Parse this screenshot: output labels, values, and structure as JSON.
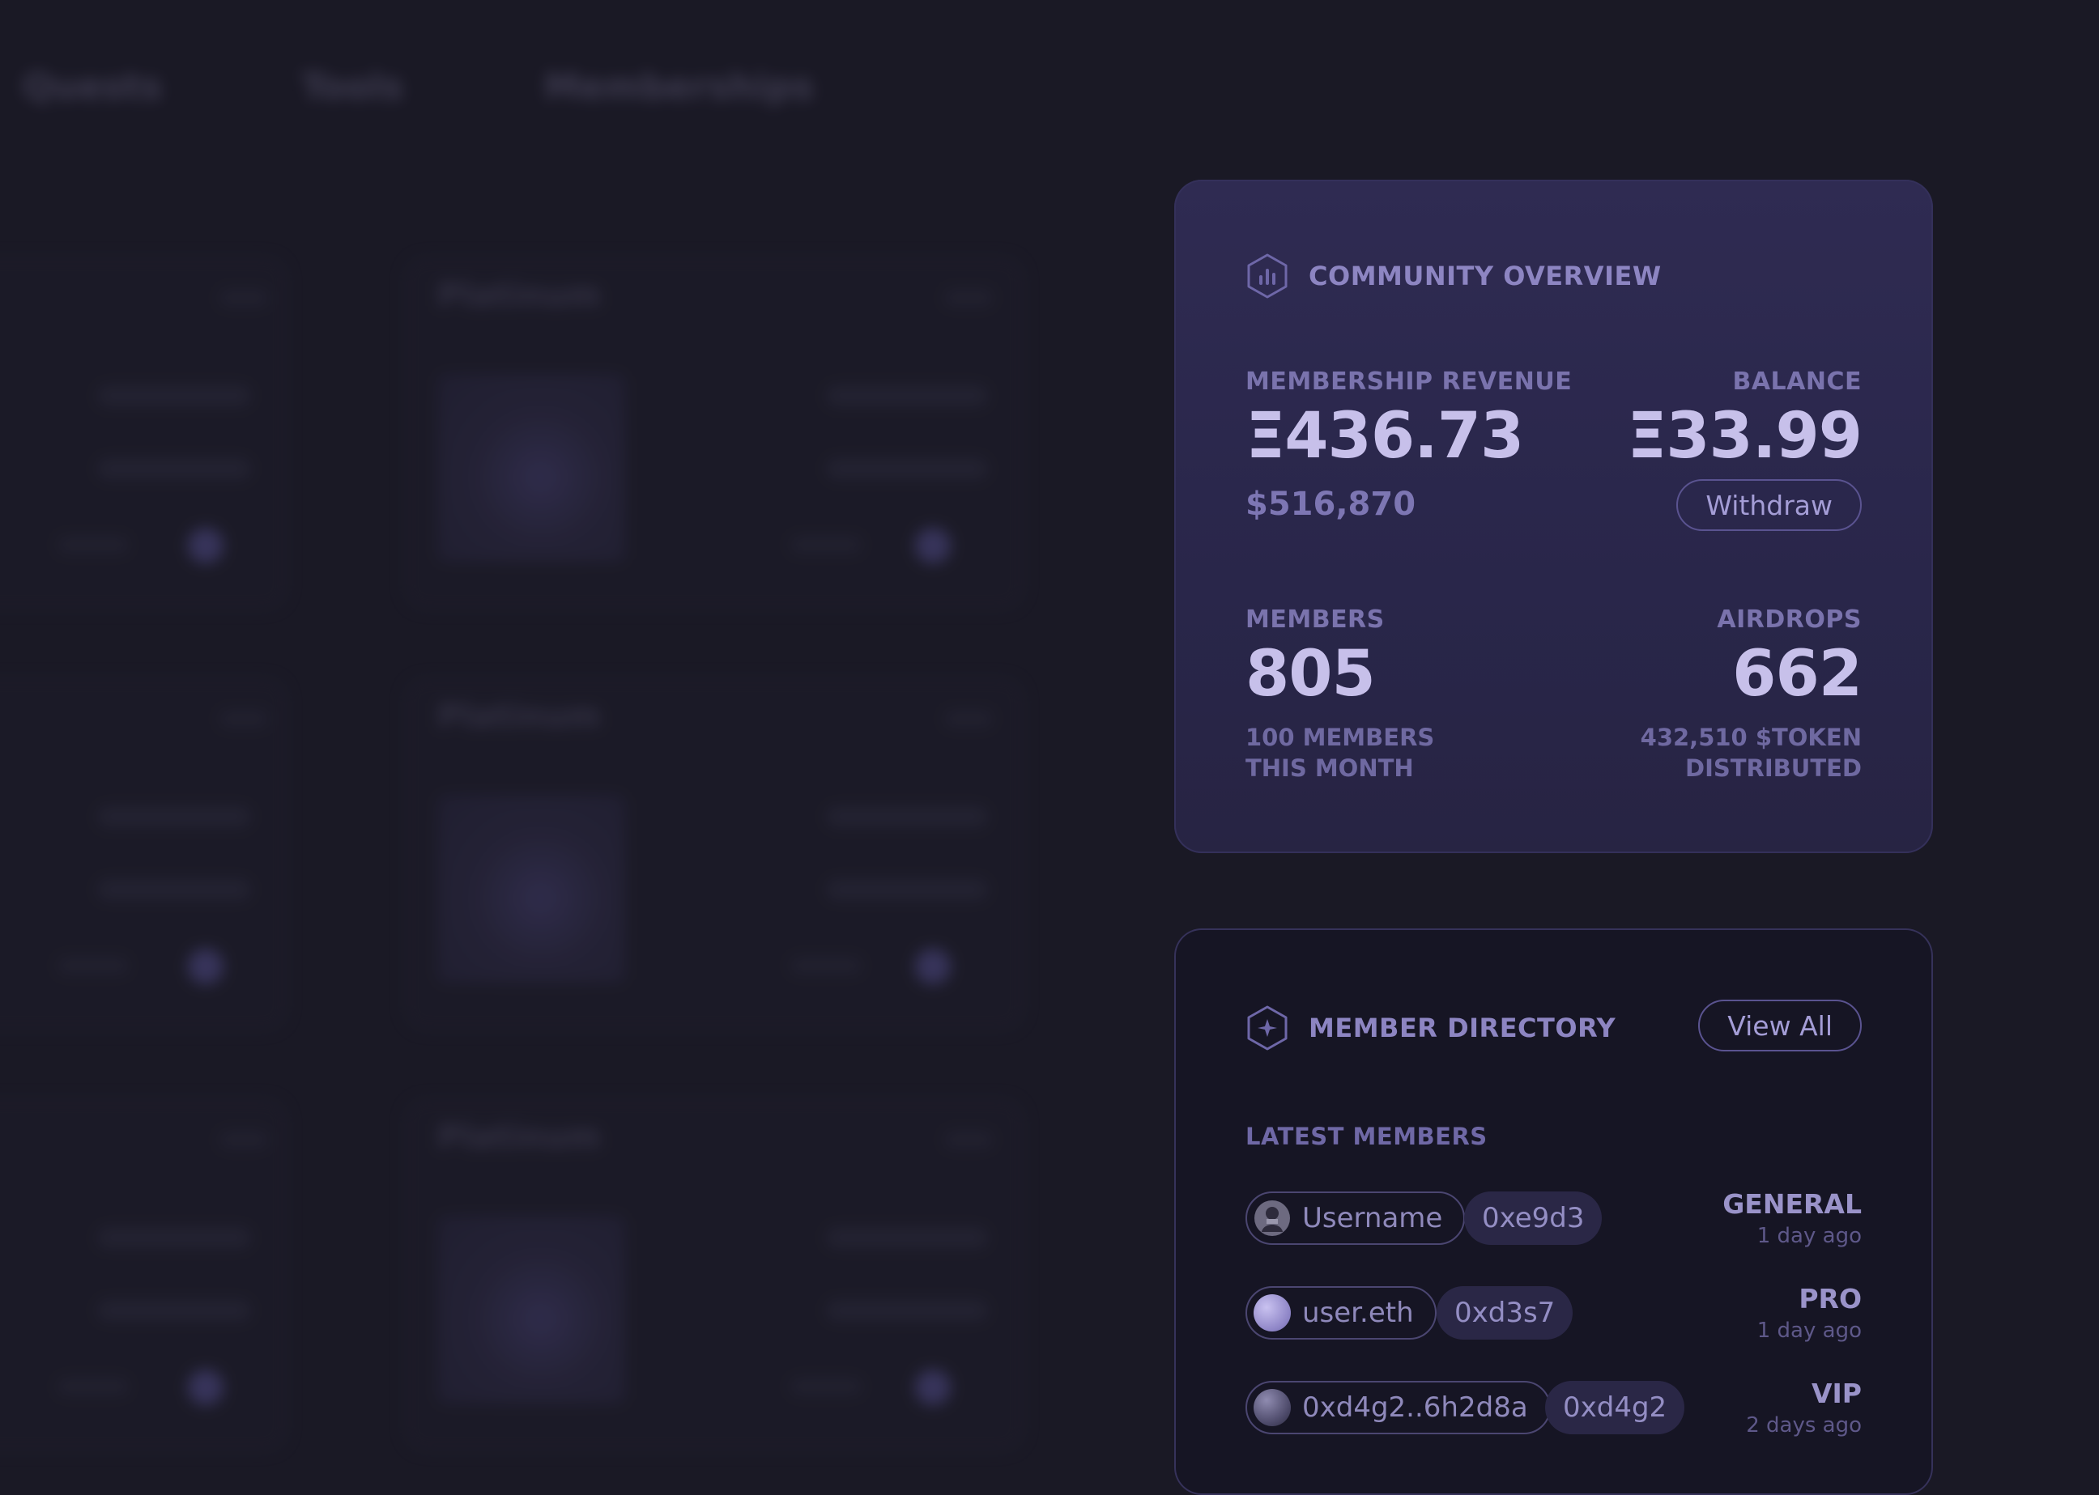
{
  "nav": {
    "tabs": [
      "Quests",
      "Tools",
      "Memberships"
    ]
  },
  "background_cards": {
    "title": "Platinum"
  },
  "overview": {
    "title": "COMMUNITY OVERVIEW",
    "icon": "chart-hex-icon",
    "revenue": {
      "label": "MEMBERSHIP REVENUE",
      "value": "Ξ436.73",
      "usd": "$516,870"
    },
    "balance": {
      "label": "BALANCE",
      "value": "Ξ33.99",
      "action": "Withdraw"
    },
    "members": {
      "label": "MEMBERS",
      "value": "805",
      "note_line1": "100 MEMBERS",
      "note_line2": "THIS MONTH"
    },
    "airdrops": {
      "label": "AIRDROPS",
      "value": "662",
      "note_line1": "432,510 $TOKEN",
      "note_line2": "DISTRIBUTED"
    }
  },
  "directory": {
    "title": "MEMBER DIRECTORY",
    "icon": "sparkle-hex-icon",
    "view_all": "View All",
    "section_label": "LATEST MEMBERS",
    "members": [
      {
        "name": "Username",
        "address": "0xe9d3",
        "tier": "GENERAL",
        "joined": "1 day ago"
      },
      {
        "name": "user.eth",
        "address": "0xd3s7",
        "tier": "PRO",
        "joined": "1 day ago"
      },
      {
        "name": "0xd4g2..6h2d8a",
        "address": "0xd4g2",
        "tier": "VIP",
        "joined": "2 days ago"
      }
    ]
  },
  "colors": {
    "background": "#1a1925",
    "overview_card": "#2c2850",
    "directory_card": "#161524",
    "accent": "#8d85c2"
  }
}
